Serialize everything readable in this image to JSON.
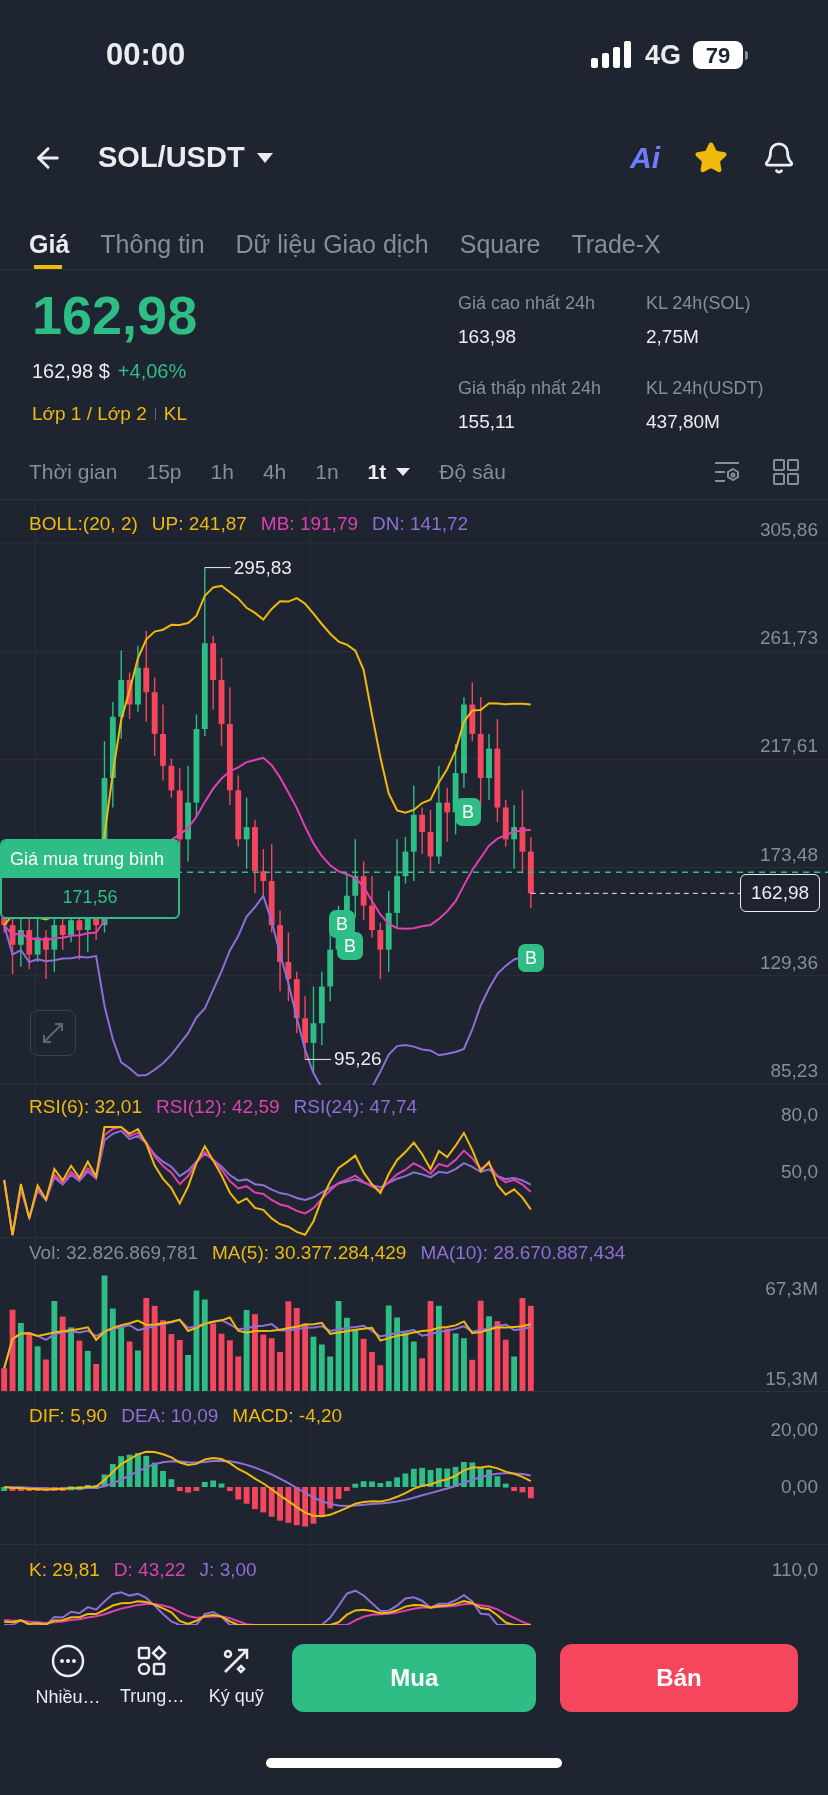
{
  "status_bar": {
    "time": "00:00",
    "network": "4G",
    "battery": "79"
  },
  "header": {
    "pair": "SOL/USDT",
    "ai_badge": "Ai",
    "favorite": true
  },
  "tabs": [
    {
      "label": "Giá",
      "selected": true
    },
    {
      "label": "Thông tin",
      "selected": false
    },
    {
      "label": "Dữ liệu Giao dịch",
      "selected": false
    },
    {
      "label": "Square",
      "selected": false
    },
    {
      "label": "Trade-X",
      "selected": false
    }
  ],
  "price": {
    "last": "162,98",
    "usd": "162,98 $",
    "change": "+4,06%",
    "tags": [
      "Lớp 1 / Lớp 2",
      "KL"
    ]
  },
  "stats": [
    {
      "label": "Giá cao nhất 24h",
      "value": "163,98"
    },
    {
      "label": "KL 24h(SOL)",
      "value": "2,75M"
    },
    {
      "label": "Giá thấp nhất 24h",
      "value": "155,11"
    },
    {
      "label": "KL 24h(USDT)",
      "value": "437,80M"
    }
  ],
  "intervals": [
    {
      "label": "Thời gian",
      "selected": false,
      "kind": "plain"
    },
    {
      "label": "15p",
      "selected": false,
      "kind": "plain"
    },
    {
      "label": "1h",
      "selected": false,
      "kind": "plain"
    },
    {
      "label": "4h",
      "selected": false,
      "kind": "plain"
    },
    {
      "label": "1n",
      "selected": false,
      "kind": "plain"
    },
    {
      "label": "1t",
      "selected": true,
      "kind": "menu"
    },
    {
      "label": "Độ sâu",
      "selected": false,
      "kind": "plain"
    }
  ],
  "main_chart": {
    "legend": [
      {
        "text": "BOLL:(20, 2)",
        "color": "#f0b90b"
      },
      {
        "text": "UP: 241,87",
        "color": "#f0b90b"
      },
      {
        "text": "MB: 191,79",
        "color": "#e040b0"
      },
      {
        "text": "DN: 141,72",
        "color": "#8f6fd6"
      }
    ],
    "yticks": [
      "305,86",
      "261,73",
      "217,61",
      "173,48",
      "129,36",
      "85,23"
    ],
    "high_label": "295,83",
    "low_label": "95,26",
    "avg_buy": {
      "label": "Giá mua trung bình",
      "value": "171,56"
    },
    "price_tag": "162,98",
    "markers": [
      "B",
      "B",
      "B",
      "B"
    ]
  },
  "rsi": {
    "legend": [
      {
        "text": "RSI(6): 32,01",
        "color": "#f0b90b"
      },
      {
        "text": "RSI(12): 42,59",
        "color": "#e040b0"
      },
      {
        "text": "RSI(24): 47,74",
        "color": "#8f6fd6"
      }
    ],
    "yticks": [
      "80,0",
      "50,0"
    ]
  },
  "volume": {
    "legend": [
      {
        "text": "Vol: 32.826.869,781",
        "color": "#848e9c"
      },
      {
        "text": "MA(5): 30.377.284,429",
        "color": "#f0b90b"
      },
      {
        "text": "MA(10): 28.670.887,434",
        "color": "#8f6fd6"
      }
    ],
    "yticks": [
      "67,3M",
      "15,3M"
    ]
  },
  "macd": {
    "legend": [
      {
        "text": "DIF: 5,90",
        "color": "#f0b90b"
      },
      {
        "text": "DEA: 10,09",
        "color": "#8f6fd6"
      },
      {
        "text": "MACD: -4,20",
        "color": "#f0b90b"
      }
    ],
    "yticks": [
      "20,00",
      "0,00"
    ]
  },
  "kdj": {
    "legend": [
      {
        "text": "K: 29,81",
        "color": "#f0b90b"
      },
      {
        "text": "D: 43,22",
        "color": "#e040b0"
      },
      {
        "text": "J: 3,00",
        "color": "#8f6fd6"
      }
    ],
    "yticks": [
      "110,0"
    ]
  },
  "bottom_bar": {
    "actions": [
      {
        "label": "Nhiều…",
        "kind": "more"
      },
      {
        "label": "Trung…",
        "kind": "shapes"
      },
      {
        "label": "Ký quỹ",
        "kind": "margin"
      }
    ],
    "buy": "Mua",
    "sell": "Bán"
  }
}
